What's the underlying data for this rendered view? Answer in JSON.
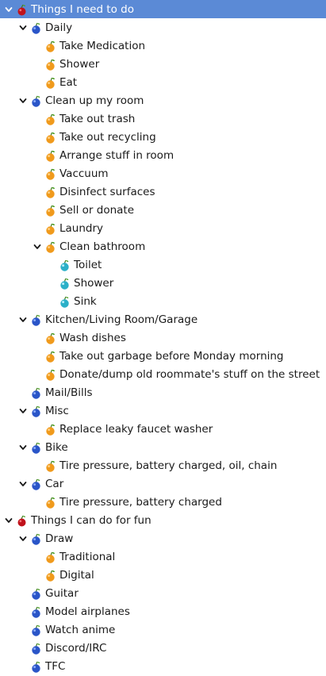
{
  "colors": {
    "selection": "#5b8ad6",
    "cherry": "#c0121b",
    "blueberry": "#2a55c8",
    "orange": "#f09a1c",
    "teal": "#2bb0c8"
  },
  "tree": [
    {
      "label": "Things I need to do",
      "depth": 0,
      "icon": "cherry-icon",
      "expanded": true,
      "selected": true
    },
    {
      "label": "Daily",
      "depth": 1,
      "icon": "blueberry-icon",
      "expanded": true
    },
    {
      "label": "Take Medication",
      "depth": 2,
      "icon": "orange-icon"
    },
    {
      "label": "Shower",
      "depth": 2,
      "icon": "orange-icon"
    },
    {
      "label": "Eat",
      "depth": 2,
      "icon": "orange-icon"
    },
    {
      "label": "Clean up my room",
      "depth": 1,
      "icon": "blueberry-icon",
      "expanded": true
    },
    {
      "label": "Take out trash",
      "depth": 2,
      "icon": "orange-icon"
    },
    {
      "label": "Take out recycling",
      "depth": 2,
      "icon": "orange-icon"
    },
    {
      "label": "Arrange stuff in room",
      "depth": 2,
      "icon": "orange-icon"
    },
    {
      "label": "Vaccuum",
      "depth": 2,
      "icon": "orange-icon"
    },
    {
      "label": "Disinfect surfaces",
      "depth": 2,
      "icon": "orange-icon"
    },
    {
      "label": "Sell or donate",
      "depth": 2,
      "icon": "orange-icon"
    },
    {
      "label": "Laundry",
      "depth": 2,
      "icon": "orange-icon"
    },
    {
      "label": "Clean bathroom",
      "depth": 2,
      "icon": "orange-icon",
      "expanded": true
    },
    {
      "label": "Toilet",
      "depth": 3,
      "icon": "teal-icon"
    },
    {
      "label": "Shower",
      "depth": 3,
      "icon": "teal-icon"
    },
    {
      "label": "Sink",
      "depth": 3,
      "icon": "teal-icon"
    },
    {
      "label": "Kitchen/Living Room/Garage",
      "depth": 1,
      "icon": "blueberry-icon",
      "expanded": true
    },
    {
      "label": "Wash dishes",
      "depth": 2,
      "icon": "orange-icon"
    },
    {
      "label": "Take out garbage before Monday morning",
      "depth": 2,
      "icon": "orange-icon"
    },
    {
      "label": "Donate/dump old roommate's stuff on the street",
      "depth": 2,
      "icon": "orange-icon"
    },
    {
      "label": "Mail/Bills",
      "depth": 1,
      "icon": "blueberry-icon"
    },
    {
      "label": "Misc",
      "depth": 1,
      "icon": "blueberry-icon",
      "expanded": true
    },
    {
      "label": "Replace leaky faucet washer",
      "depth": 2,
      "icon": "orange-icon"
    },
    {
      "label": "Bike",
      "depth": 1,
      "icon": "blueberry-icon",
      "expanded": true
    },
    {
      "label": "Tire pressure, battery charged, oil, chain",
      "depth": 2,
      "icon": "orange-icon"
    },
    {
      "label": "Car",
      "depth": 1,
      "icon": "blueberry-icon",
      "expanded": true
    },
    {
      "label": "Tire pressure, battery charged",
      "depth": 2,
      "icon": "orange-icon"
    },
    {
      "label": "Things I can do for fun",
      "depth": 0,
      "icon": "cherry-icon",
      "expanded": true
    },
    {
      "label": "Draw",
      "depth": 1,
      "icon": "blueberry-icon",
      "expanded": true
    },
    {
      "label": "Traditional",
      "depth": 2,
      "icon": "orange-icon"
    },
    {
      "label": "Digital",
      "depth": 2,
      "icon": "orange-icon"
    },
    {
      "label": "Guitar",
      "depth": 1,
      "icon": "blueberry-icon"
    },
    {
      "label": "Model airplanes",
      "depth": 1,
      "icon": "blueberry-icon"
    },
    {
      "label": "Watch anime",
      "depth": 1,
      "icon": "blueberry-icon"
    },
    {
      "label": "Discord/IRC",
      "depth": 1,
      "icon": "blueberry-icon"
    },
    {
      "label": "TFC",
      "depth": 1,
      "icon": "blueberry-icon"
    }
  ]
}
